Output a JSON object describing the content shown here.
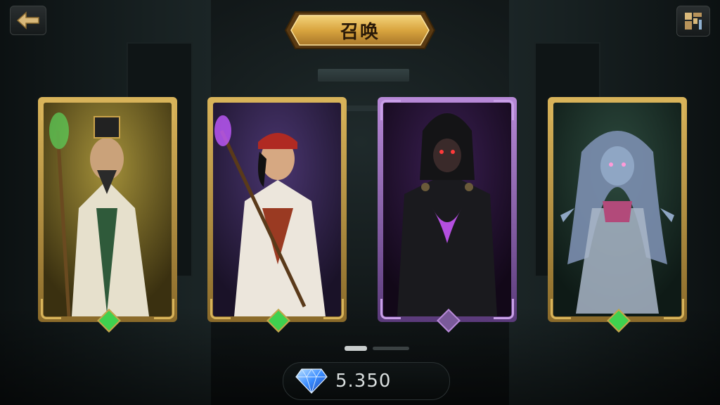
{
  "header": {
    "title": "召唤",
    "back_icon": "back-arrow-icon",
    "menu_icon": "map-menu-icon"
  },
  "cards": [
    {
      "id": "sage",
      "rarity_color": "#3fd14f",
      "frame_color": "#c9a24a",
      "art_bg": "#8a7a2a"
    },
    {
      "id": "monk",
      "rarity_color": "#3fd14f",
      "frame_color": "#c9a24a",
      "art_bg": "#3a2a52"
    },
    {
      "id": "reaper",
      "rarity_color": "#7a5a9a",
      "frame_color": "#9a6cc0",
      "art_bg": "#2a1738"
    },
    {
      "id": "ghost",
      "rarity_color": "#3fd14f",
      "frame_color": "#c9a24a",
      "art_bg": "#1f3a2e"
    }
  ],
  "pager": {
    "pages": 2,
    "current": 1
  },
  "currency": {
    "icon": "diamond-icon",
    "amount": "5.350"
  }
}
